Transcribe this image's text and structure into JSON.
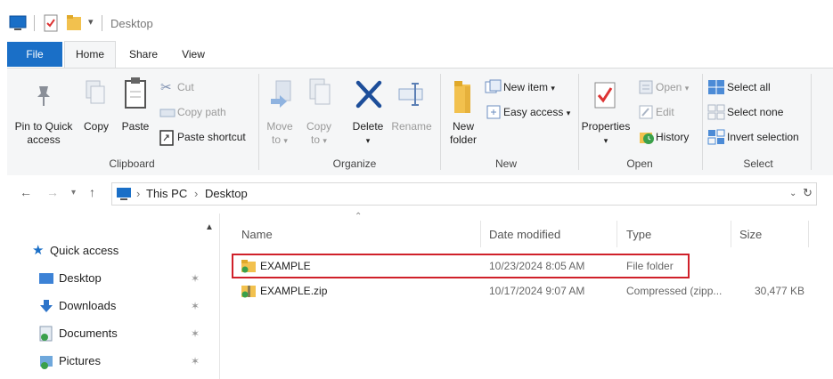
{
  "titlebar": {
    "title": "Desktop"
  },
  "tabs": [
    "File",
    "Home",
    "Share",
    "View"
  ],
  "clipboard": {
    "pin_label": "Pin to Quick access",
    "copy_label": "Copy",
    "paste_label": "Paste",
    "cut_label": "Cut",
    "copy_path_label": "Copy path",
    "paste_shortcut_label": "Paste shortcut",
    "group_label": "Clipboard"
  },
  "organize": {
    "move_to_label": "Move to",
    "copy_to_label": "Copy to",
    "delete_label": "Delete",
    "rename_label": "Rename",
    "group_label": "Organize"
  },
  "new": {
    "new_folder_label": "New folder",
    "new_item_label": "New item",
    "easy_access_label": "Easy access",
    "group_label": "New"
  },
  "open": {
    "properties_label": "Properties",
    "open_label": "Open",
    "edit_label": "Edit",
    "history_label": "History",
    "group_label": "Open"
  },
  "select": {
    "select_all_label": "Select all",
    "select_none_label": "Select none",
    "invert_label": "Invert selection",
    "group_label": "Select"
  },
  "address": {
    "crumbs": [
      "This PC",
      "Desktop"
    ]
  },
  "nav": {
    "quick_access": "Quick access",
    "items": [
      "Desktop",
      "Downloads",
      "Documents",
      "Pictures"
    ]
  },
  "columns": {
    "name": "Name",
    "date": "Date modified",
    "type": "Type",
    "size": "Size"
  },
  "files": [
    {
      "name": "EXAMPLE",
      "date": "10/23/2024 8:05 AM",
      "type": "File folder",
      "size": ""
    },
    {
      "name": "EXAMPLE.zip",
      "date": "10/17/2024 9:07 AM",
      "type": "Compressed (zipp...",
      "size": "30,477 KB"
    }
  ],
  "colors": {
    "accent": "#1a6fc7",
    "folder": "#f2c14e",
    "highlight": "#d0202a"
  },
  "icons": [
    "monitor-icon",
    "properties-icon",
    "folder-icon",
    "qat-dropdown-icon",
    "pin-icon",
    "copy-icon",
    "paste-icon",
    "scissors-icon",
    "copy-path-icon",
    "paste-shortcut-icon",
    "move-to-icon",
    "copy-to-icon",
    "delete-icon",
    "rename-icon",
    "new-folder-icon",
    "new-item-icon",
    "easy-access-icon",
    "open-icon",
    "edit-icon",
    "history-icon",
    "select-all-icon",
    "select-none-icon",
    "invert-selection-icon",
    "star-icon",
    "download-icon",
    "documents-icon",
    "pictures-icon",
    "refresh-icon",
    "zip-icon"
  ]
}
